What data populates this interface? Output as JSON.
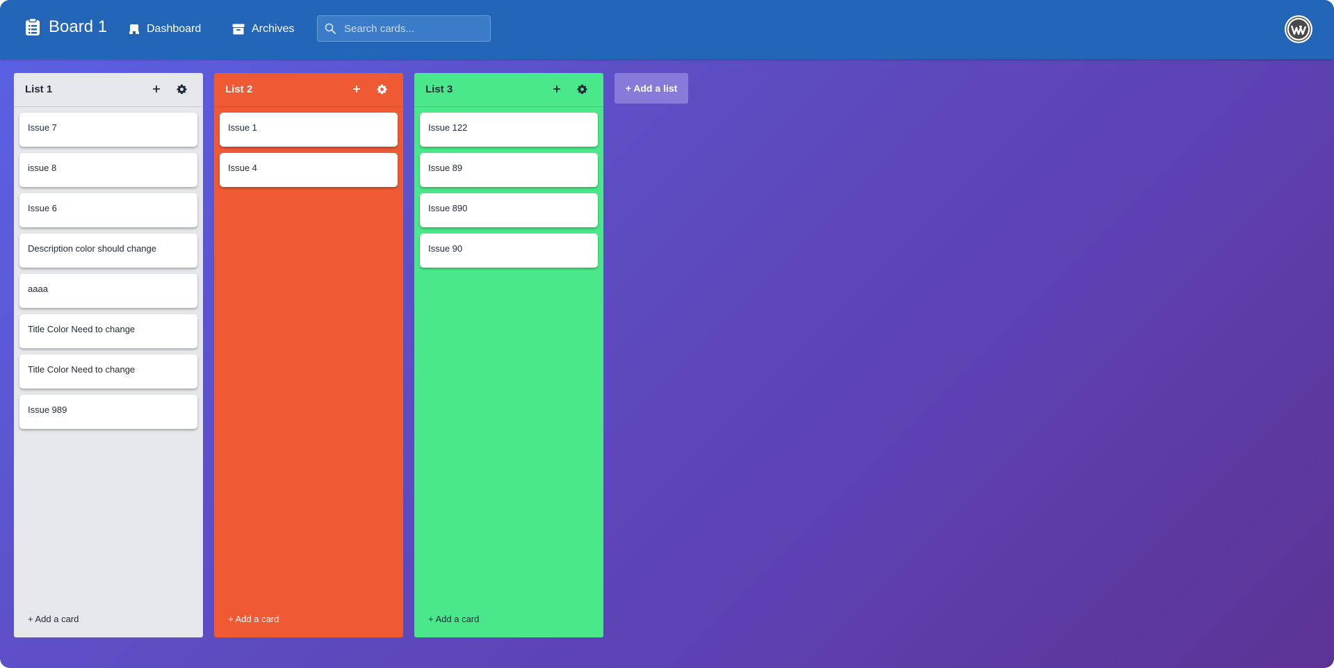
{
  "header": {
    "board_title": "Board 1",
    "nav": [
      {
        "label": "Dashboard",
        "icon": "dashboard-icon"
      },
      {
        "label": "Archives",
        "icon": "archive-icon"
      }
    ],
    "search": {
      "placeholder": "Search cards...",
      "value": ""
    },
    "avatar_icon": "wordpress-icon"
  },
  "lists": [
    {
      "title": "List 1",
      "color": "#e5e7eb",
      "text_color": "#1f2937",
      "cards": [
        "Issue 7",
        "issue 8",
        "Issue 6",
        "Description color should change",
        "aaaa",
        "Title Color Need to change",
        "Title Color Need to change",
        "Issue 989"
      ],
      "add_card_label": "+ Add a card"
    },
    {
      "title": "List 2",
      "color": "#ef5a35",
      "text_color": "#ffffff",
      "cards": [
        "Issue 1",
        "Issue 4"
      ],
      "add_card_label": "+ Add a card"
    },
    {
      "title": "List 3",
      "color": "#4ae88a",
      "text_color": "#1f2937",
      "cards": [
        "Issue 122",
        "Issue 89",
        "Issue 890",
        "Issue 90"
      ],
      "add_card_label": "+ Add a card"
    }
  ],
  "add_list_label": "+ Add a list"
}
